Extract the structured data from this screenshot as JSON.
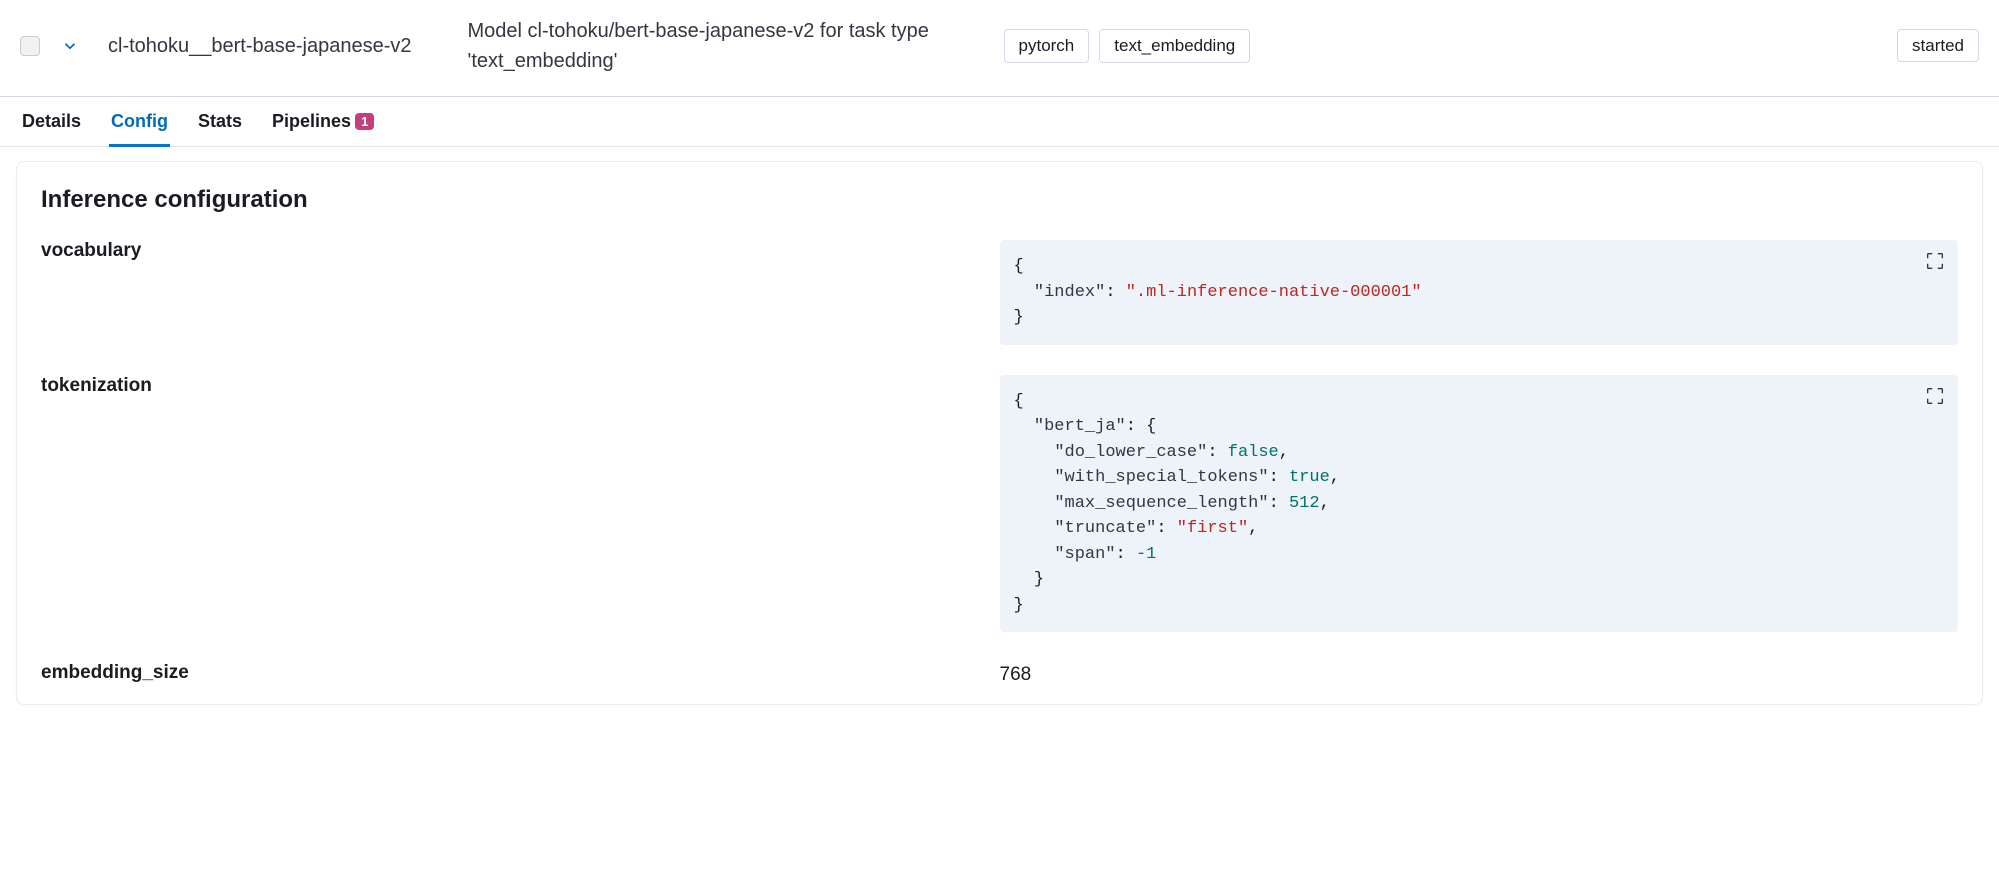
{
  "header": {
    "model_name": "cl-tohoku__bert-base-japanese-v2",
    "description": "Model cl-tohoku/bert-base-japanese-v2 for task type 'text_embedding'",
    "badges": [
      "pytorch",
      "text_embedding"
    ],
    "status": "started"
  },
  "tabs": [
    {
      "label": "Details",
      "active": false
    },
    {
      "label": "Config",
      "active": true
    },
    {
      "label": "Stats",
      "active": false
    },
    {
      "label": "Pipelines",
      "active": false,
      "badge": "1"
    }
  ],
  "panel": {
    "title": "Inference configuration",
    "fields": {
      "vocabulary_label": "vocabulary",
      "tokenization_label": "tokenization",
      "embedding_size_label": "embedding_size",
      "embedding_size_value": "768"
    },
    "json": {
      "vocabulary": {
        "index": ".ml-inference-native-000001"
      },
      "tokenization": {
        "bert_ja": {
          "do_lower_case": false,
          "with_special_tokens": true,
          "max_sequence_length": 512,
          "truncate": "first",
          "span": -1
        }
      }
    }
  }
}
